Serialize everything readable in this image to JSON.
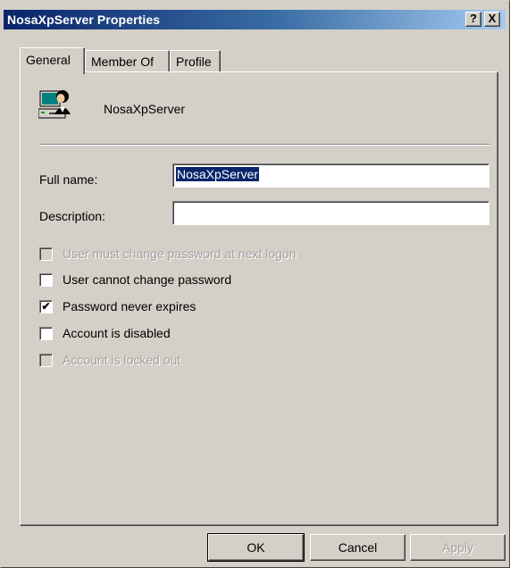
{
  "window": {
    "title": "NosaXpServer Properties",
    "help_label": "?",
    "close_label": "X"
  },
  "tabs": [
    {
      "label": "General",
      "active": true
    },
    {
      "label": "Member Of",
      "active": false
    },
    {
      "label": "Profile",
      "active": false
    }
  ],
  "general": {
    "icon": "user-computer-icon",
    "username": "NosaXpServer",
    "full_name_label": "Full name:",
    "full_name_value": "NosaXpServer",
    "description_label": "Description:",
    "description_value": ""
  },
  "options": [
    {
      "label": "User must change password at next logon",
      "checked": false,
      "enabled": false
    },
    {
      "label": "User cannot change password",
      "checked": false,
      "enabled": true
    },
    {
      "label": "Password never expires",
      "checked": true,
      "enabled": true
    },
    {
      "label": "Account is disabled",
      "checked": false,
      "enabled": true
    },
    {
      "label": "Account is locked out",
      "checked": false,
      "enabled": false
    }
  ],
  "buttons": {
    "ok": "OK",
    "cancel": "Cancel",
    "apply": "Apply"
  },
  "colors": {
    "titlebar_start": "#0a246a",
    "titlebar_end": "#a6caf0",
    "face": "#d4d0c8",
    "selection": "#0a246a"
  }
}
